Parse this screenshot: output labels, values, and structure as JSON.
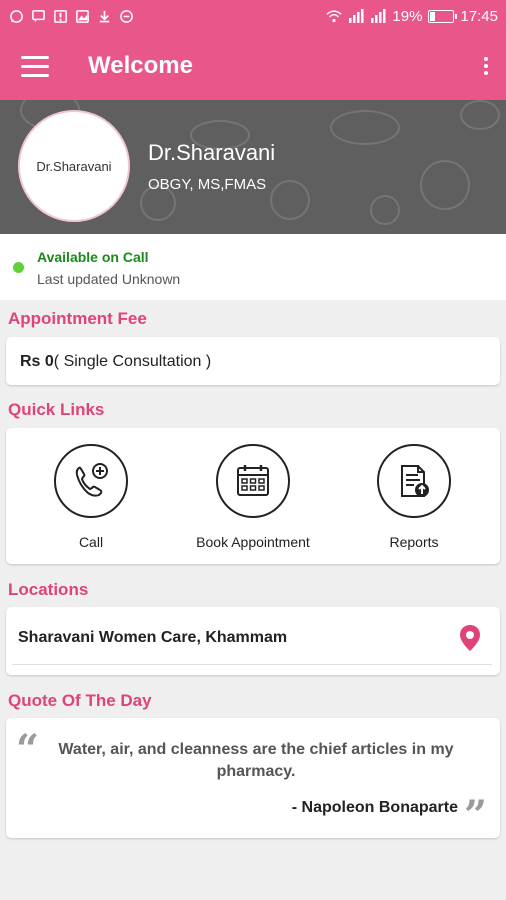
{
  "status_bar": {
    "battery": "19%",
    "time": "17:45",
    "left_icons": [
      "whatsapp-icon",
      "message-icon",
      "alert-icon",
      "image-icon",
      "download-icon",
      "minus-circle-icon"
    ],
    "right_icons": [
      "wifi-icon",
      "signal-icon",
      "signal-icon",
      "battery-icon"
    ]
  },
  "app_bar": {
    "title": "Welcome",
    "menu_icon": "hamburger-menu-icon",
    "more_icon": "more-vertical-icon"
  },
  "profile": {
    "avatar_text": "Dr.Sharavani",
    "name": "Dr.Sharavani",
    "qualification": "OBGY, MS,FMAS"
  },
  "availability": {
    "status": "Available on Call",
    "last_updated": "Last updated Unknown"
  },
  "appointment_fee": {
    "title": "Appointment Fee",
    "amount": "Rs 0",
    "detail": "( Single Consultation )"
  },
  "quick_links": {
    "title": "Quick Links",
    "items": [
      {
        "label": "Call",
        "icon": "call-add-icon"
      },
      {
        "label": "Book Appointment",
        "icon": "calendar-icon"
      },
      {
        "label": "Reports",
        "icon": "report-upload-icon"
      }
    ]
  },
  "locations": {
    "title": "Locations",
    "items": [
      {
        "name": "Sharavani Women Care, Khammam",
        "icon": "location-pin-icon"
      }
    ]
  },
  "quote": {
    "title": "Quote Of The Day",
    "text": "Water, air, and cleanness are the chief articles in my pharmacy.",
    "author": "- Napoleon Bonaparte"
  },
  "colors": {
    "primary": "#e9578a",
    "section_title": "#e0427a",
    "available": "#1a8a1a",
    "available_dot": "#5fcf3a",
    "background": "#efefef"
  }
}
